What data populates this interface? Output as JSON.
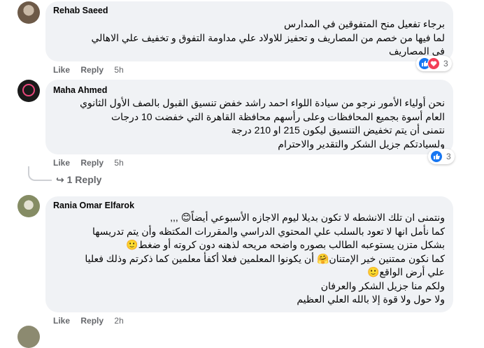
{
  "comments": [
    {
      "author": "Rehab Saeed",
      "lines": [
        "برجاء تفعيل منح المتفوقين في المدارس",
        "لما فيها من خصم من المصاريف و تحفيز للاولاد علي مداومة التفوق و تخفيف علي الاهالي",
        "في المصاريف"
      ],
      "like": "Like",
      "reply": "Reply",
      "time": "5h",
      "reactions": "3"
    },
    {
      "author": "Maha Ahmed",
      "lines": [
        "نحن أولياء الأمور نرجو من سيادة اللواء احمد راشد خفض تنسيق القبول بالصف الأول الثانوي",
        "العام أسوة بجميع المحافظات وعلى رأسهم محافظة القاهرة التي خفضت 10 درجات",
        "نتمنى أن يتم تخفيض التنسيق ليكون 215 او 210 درجة",
        "ولسيادتكم جزيل الشكر والتقدير والاحترام"
      ],
      "like": "Like",
      "reply": "Reply",
      "time": "5h",
      "reactions": "3",
      "replies_link": "1 Reply"
    },
    {
      "author": "Rania Omar Elfarok",
      "lines": [
        "ونتمنى ان تلك الانشطه لا تكون بديلا ليوم الاجازه الأسبوعي أيضاً😊 ,,,",
        "كما نأمل انها لا تعود بالسلب علي المحتوي الدراسي والمقررات المكتظه وأن يتم تدريسها",
        "بشكل متزن يستوعبه الطالب بصوره واضحه مريحه لذهنه دون كروته أو ضغط🙂",
        "كما نكون ممتنين خير الإمتنان🤗 أن يكونوا المعلمين فعلا أكفأ معلمين كما ذكرتم وذلك فعليا",
        "علي أرض الواقع🙂",
        "ولكم منا جزيل الشكر والعرفان",
        "ولا حول ولا قوة إلا بالله العلي العظيم"
      ],
      "like": "Like",
      "reply": "Reply",
      "time": "2h"
    }
  ],
  "colors": {
    "bubble": "#f0f2f5",
    "meta_text": "#65676b",
    "like_blue": "#1877f2",
    "love_red": "#f33e58"
  }
}
